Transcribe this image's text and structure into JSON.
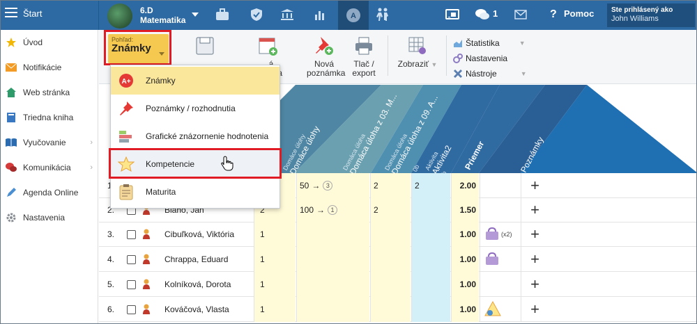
{
  "topbar": {
    "start_label": "Štart",
    "class_name": "6.D",
    "subject": "Matematika",
    "messages_count": "1",
    "help_label": "Pomoc",
    "logged_in_label": "Ste prihlásený ako",
    "user_name": "John Williams"
  },
  "sidebar": {
    "items": [
      {
        "label": "Úvod",
        "icon": "star-icon"
      },
      {
        "label": "Notifikácie",
        "icon": "envelope-icon"
      },
      {
        "label": "Web stránka",
        "icon": "home-icon"
      },
      {
        "label": "Triedna kniha",
        "icon": "book-icon"
      },
      {
        "label": "Vyučovanie",
        "icon": "open-book-icon"
      },
      {
        "label": "Komunikácia",
        "icon": "chat-icon"
      },
      {
        "label": "Agenda Online",
        "icon": "pen-icon"
      },
      {
        "label": "Nastavenia",
        "icon": "gear-icon"
      }
    ]
  },
  "ribbon": {
    "view_label": "Pohľad:",
    "view_value": "Známky",
    "tools": {
      "save_hidden": "",
      "new_grade_line1": "...á známka",
      "new_grade_line2": "...e",
      "new_note_line1": "Nová",
      "new_note_line2": "poznámka",
      "print_line1": "Tlač /",
      "print_line2": "export",
      "view_dropdown": "Zobraziť"
    },
    "list": [
      "Štatistika",
      "Nastavenia",
      "Nástroje"
    ]
  },
  "dropdown": {
    "items": [
      {
        "label": "Známky",
        "icon": "grade-icon"
      },
      {
        "label": "Poznámky / rozhodnutia",
        "icon": "pin-icon"
      },
      {
        "label": "Grafické znázornenie hodnotenia",
        "icon": "chart-bars-icon"
      },
      {
        "label": "Kompetencie",
        "icon": "star-outline-icon"
      },
      {
        "label": "Maturita",
        "icon": "clipboard-icon"
      }
    ]
  },
  "columns": [
    {
      "small": "Domáce úlohy",
      "big": "Domáce úlohy",
      "sub": ""
    },
    {
      "small": "Domáca úloha",
      "big": "Domáca úloha z 03. M...",
      "sub": "%"
    },
    {
      "small": "Domáca úloha",
      "big": "Domáca úloha z 09. A...",
      "sub": ""
    },
    {
      "small": "Aktivita",
      "big": "Aktivita2",
      "sub": "0b"
    },
    {
      "small": "",
      "big": "Priemer",
      "sub": ""
    },
    {
      "small": "",
      "big": "Poznámky",
      "sub": ""
    }
  ],
  "extra_column_sub": "0b",
  "rows": [
    {
      "num": "1.",
      "name": "",
      "c1": "",
      "c2": "50",
      "c2_badge": "3",
      "c3": "2",
      "c4": "2",
      "avg": "2.00",
      "note": "",
      "note_count": ""
    },
    {
      "num": "2.",
      "name": "Blaho, Ján",
      "c1": "2",
      "c2": "100",
      "c2_badge": "1",
      "c3": "2",
      "c4": "",
      "avg": "1.50",
      "note": "",
      "note_count": ""
    },
    {
      "num": "3.",
      "name": "Cibuľková, Viktória",
      "c1": "1",
      "c2": "",
      "c2_badge": "",
      "c3": "",
      "c4": "",
      "avg": "1.00",
      "note": "bag",
      "note_count": "(x2)"
    },
    {
      "num": "4.",
      "name": "Chrappa, Eduard",
      "c1": "1",
      "c2": "",
      "c2_badge": "",
      "c3": "",
      "c4": "",
      "avg": "1.00",
      "note": "bag",
      "note_count": ""
    },
    {
      "num": "5.",
      "name": "Kolníková, Dorota",
      "c1": "1",
      "c2": "",
      "c2_badge": "",
      "c3": "",
      "c4": "",
      "avg": "1.00",
      "note": "",
      "note_count": ""
    },
    {
      "num": "6.",
      "name": "Kováčová, Vlasta",
      "c1": "1",
      "c2": "",
      "c2_badge": "",
      "c3": "",
      "c4": "",
      "avg": "1.00",
      "note": "warning",
      "note_count": ""
    }
  ],
  "arrow": "→",
  "plus": "+"
}
